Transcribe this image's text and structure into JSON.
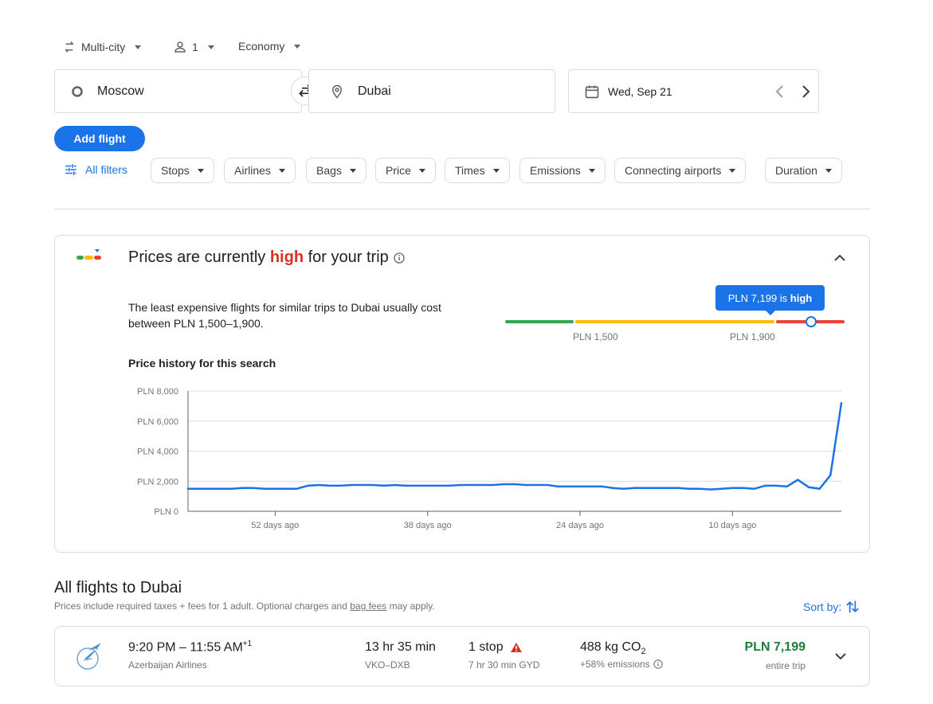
{
  "search": {
    "trip_type": "Multi-city",
    "passengers": "1",
    "cabin_class": "Economy",
    "origin": "Moscow",
    "destination": "Dubai",
    "date": "Wed, Sep 21",
    "add_flight_label": "Add flight"
  },
  "filters": {
    "all_filters_label": "All filters",
    "chips": [
      "Stops",
      "Airlines",
      "Bags",
      "Price",
      "Times",
      "Emissions",
      "Connecting airports",
      "Duration"
    ]
  },
  "price_insight": {
    "heading_prefix": "Prices are currently ",
    "heading_level": "high",
    "heading_suffix": " for your trip",
    "description_line1": "The least expensive flights for similar trips to Dubai usually cost",
    "description_line2": "between PLN 1,500–1,900.",
    "tooltip_prefix": "PLN 7,199 is ",
    "tooltip_level": "high",
    "range_low_label": "PLN 1,500",
    "range_high_label": "PLN 1,900",
    "range_low": 1500,
    "range_high": 1900,
    "current_price": 7199,
    "history_title": "Price history for this search",
    "colors": {
      "low": "#34a853",
      "typical": "#fbbc04",
      "high": "#ea4335",
      "line": "#1a73e8"
    }
  },
  "chart_data": {
    "type": "line",
    "title": "Price history for this search",
    "xlabel": "",
    "ylabel": "",
    "ylim": [
      0,
      8000
    ],
    "y_ticks": [
      "PLN 8,000",
      "PLN 6,000",
      "PLN 4,000",
      "PLN 2,000",
      "PLN 0"
    ],
    "y_tick_values": [
      8000,
      6000,
      4000,
      2000,
      0
    ],
    "x_ticks": [
      "52 days ago",
      "38 days ago",
      "24 days ago",
      "10 days ago"
    ],
    "x_tick_values": [
      52,
      38,
      24,
      10
    ],
    "xlim": [
      60,
      0
    ],
    "grid": true,
    "series": [
      {
        "days_ago": [
          60,
          59,
          58,
          57,
          56,
          55,
          54,
          53,
          52,
          51,
          50,
          49,
          48,
          47,
          46,
          45,
          44,
          43,
          42,
          41,
          40,
          39,
          38,
          37,
          36,
          35,
          34,
          33,
          32,
          31,
          30,
          29,
          28,
          27,
          26,
          25,
          24,
          23,
          22,
          21,
          20,
          19,
          18,
          17,
          16,
          15,
          14,
          13,
          12,
          11,
          10,
          9,
          8,
          7,
          6,
          5,
          4,
          3,
          2,
          1,
          0
        ],
        "values": [
          1500,
          1500,
          1500,
          1500,
          1500,
          1550,
          1550,
          1500,
          1500,
          1500,
          1500,
          1700,
          1750,
          1700,
          1700,
          1750,
          1750,
          1750,
          1700,
          1750,
          1700,
          1700,
          1700,
          1700,
          1700,
          1750,
          1750,
          1750,
          1750,
          1800,
          1800,
          1750,
          1750,
          1750,
          1650,
          1650,
          1650,
          1650,
          1650,
          1550,
          1500,
          1550,
          1550,
          1550,
          1550,
          1550,
          1500,
          1500,
          1450,
          1500,
          1550,
          1550,
          1500,
          1700,
          1700,
          1650,
          2100,
          1600,
          1500,
          2400,
          7199
        ]
      }
    ]
  },
  "results": {
    "heading": "All flights to Dubai",
    "subtext_prefix": "Prices include required taxes + fees for 1 adult. Optional charges and ",
    "subtext_link": "bag fees",
    "subtext_suffix": " may apply.",
    "sort_label": "Sort by:",
    "flights": [
      {
        "times": "9:20 PM – 11:55 AM",
        "day_offset": "+1",
        "airline": "Azerbaijan Airlines",
        "duration": "13 hr 35 min",
        "route": "VKO–DXB",
        "stops": "1 stop",
        "layover": "7 hr 30 min GYD",
        "emissions_prefix": "488 kg CO",
        "emissions_sub": "2",
        "emissions_note": "+58% emissions",
        "price": "PLN 7,199",
        "price_note": "entire trip"
      }
    ]
  }
}
